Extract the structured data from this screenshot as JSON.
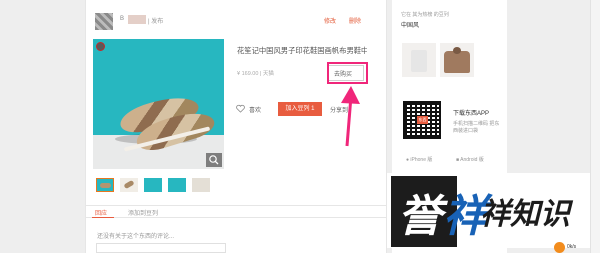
{
  "post": {
    "user_prefix": "B",
    "publish_label": "| 发布",
    "modify_label": "修改",
    "delete_label": "删除"
  },
  "product": {
    "title": "花笙记中国风男子印花鞋国画帆布男鞋中",
    "price": "¥ 169.00 | 天猫",
    "buy_label": "去购买",
    "like_label": "喜欢",
    "add_label": "加入豆列 1",
    "share_label": "分享到"
  },
  "tabs": [
    "回应",
    "添加到豆列"
  ],
  "comment": {
    "prompt": "还没有关于这个东西的评论..."
  },
  "sidebar": {
    "from_label": "它在 其为热榜 的豆列",
    "list_name": "中国风"
  },
  "app": {
    "title": "下载东西APP",
    "desc": "手机扫描二维码 把东西装进口袋",
    "iphone": "iPhone 版",
    "android": "Android 版",
    "qr_logo": "东西"
  },
  "watermark": {
    "c1": "誉",
    "c2": "祥",
    "rest": "祥知识"
  },
  "ad": {
    "label": "0k/s"
  },
  "colors": {
    "accent": "#e85c3f",
    "arrow": "#f0267a",
    "watermark_blue": "#1862b6"
  }
}
